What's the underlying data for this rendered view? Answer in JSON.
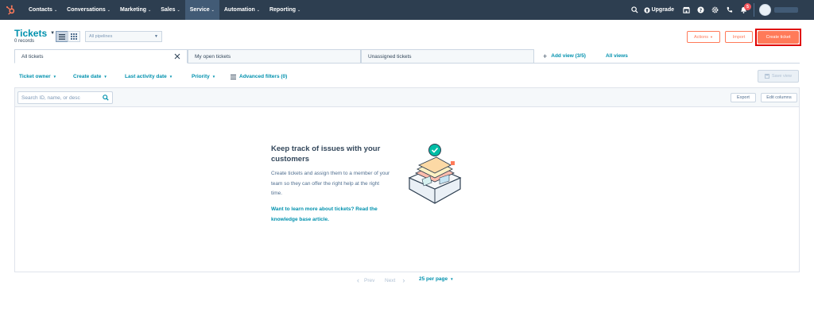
{
  "nav": {
    "items": [
      {
        "label": "Contacts"
      },
      {
        "label": "Conversations"
      },
      {
        "label": "Marketing"
      },
      {
        "label": "Sales"
      },
      {
        "label": "Service"
      },
      {
        "label": "Automation"
      },
      {
        "label": "Reporting"
      }
    ],
    "active": "Service",
    "upgrade_label": "Upgrade",
    "notification_count": "5"
  },
  "header": {
    "title": "Tickets",
    "records": "0 records",
    "pipeline_placeholder": "All pipelines",
    "actions_label": "Actions",
    "import_label": "Import",
    "create_label": "Create ticket"
  },
  "tabs": [
    {
      "label": "All tickets"
    },
    {
      "label": "My open tickets"
    },
    {
      "label": "Unassigned tickets"
    }
  ],
  "add_view_label": "Add view (3/5)",
  "all_views_label": "All views",
  "filters": {
    "owner": "Ticket owner",
    "create_date": "Create date",
    "last_activity": "Last activity date",
    "priority": "Priority",
    "advanced": "Advanced filters (0)",
    "save_view": "Save view"
  },
  "table": {
    "search_placeholder": "Search ID, name, or desc",
    "export_label": "Export",
    "edit_columns_label": "Edit columns"
  },
  "empty_state": {
    "title": "Keep track of issues with your customers",
    "description": "Create tickets and assign them to a member of your team so they can offer the right help at the right time.",
    "link": "Want to learn more about tickets? Read the knowledge base article."
  },
  "pagination": {
    "prev": "Prev",
    "next": "Next",
    "per_page": "25 per page"
  },
  "colors": {
    "nav_bg": "#2d3e50",
    "accent": "#ff7a59",
    "link": "#0091ae",
    "highlight_outline": "#e00000"
  }
}
